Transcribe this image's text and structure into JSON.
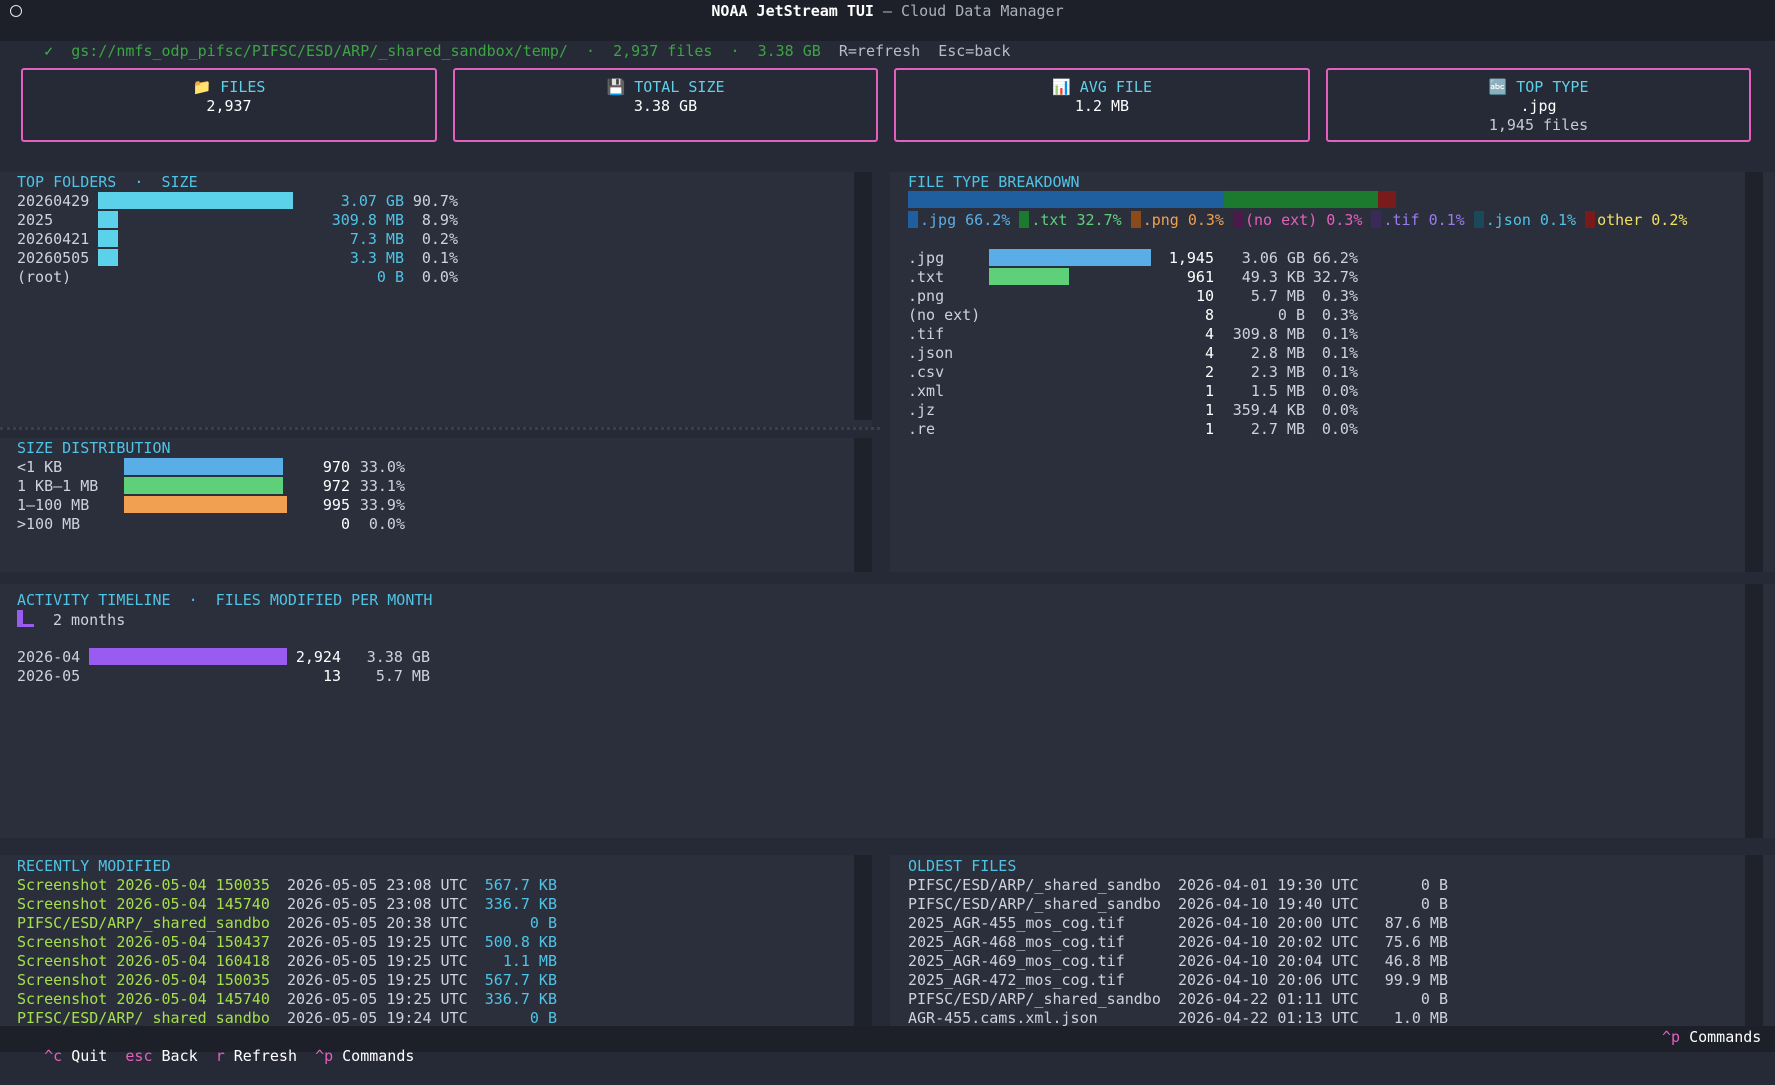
{
  "window": {
    "title_bold": "NOAA JetStream TUI",
    "title_rest": " — Cloud Data Manager"
  },
  "status": {
    "check": "✓",
    "path": "gs://nmfs_odp_pifsc/PIFSC/ESD/ARP/_shared_sandbox/temp/",
    "sep1": "·",
    "files": "2,937 files",
    "sep2": "·",
    "size": "3.38 GB",
    "hint_refresh": "R=refresh",
    "hint_back": "Esc=back"
  },
  "cards": {
    "files": {
      "icon": "📁",
      "label": "FILES",
      "value": "2,937"
    },
    "total": {
      "icon": "💾",
      "label": "TOTAL SIZE",
      "value": "3.38 GB"
    },
    "avg": {
      "icon": "📊",
      "label": "AVG FILE",
      "value": "1.2 MB"
    },
    "top": {
      "icon": "🔤",
      "label": "TOP TYPE",
      "value": ".jpg",
      "sub": "1,945 files"
    }
  },
  "top_folders": {
    "header": "TOP FOLDERS  ·  SIZE",
    "rows": [
      {
        "name": "20260429",
        "size": "3.07 GB",
        "pct": "90.7%",
        "frac": 0.907
      },
      {
        "name": "2025",
        "size": "309.8 MB",
        "pct": "8.9%",
        "frac": 0.089
      },
      {
        "name": "20260421",
        "size": "7.3 MB",
        "pct": "0.2%",
        "frac": 0.002
      },
      {
        "name": "20260505",
        "size": "3.3 MB",
        "pct": "0.1%",
        "frac": 0.001
      },
      {
        "name": "(root)",
        "size": "0 B",
        "pct": "0.0%",
        "frac": 0
      }
    ]
  },
  "size_dist": {
    "header": "SIZE DISTRIBUTION",
    "rows": [
      {
        "label": "<1 KB",
        "count": "970",
        "pct": "33.0%",
        "frac": 0.975,
        "color": "#5aaee8"
      },
      {
        "label": "1 KB–1 MB",
        "count": "972",
        "pct": "33.1%",
        "frac": 0.977,
        "color": "#5fd07a"
      },
      {
        "label": "1–100 MB",
        "count": "995",
        "pct": "33.9%",
        "frac": 1.0,
        "color": "#f0a050"
      },
      {
        "label": ">100 MB",
        "count": "0",
        "pct": "0.0%",
        "frac": 0,
        "color": "#888888"
      }
    ]
  },
  "file_types": {
    "header": "FILE TYPE BREAKDOWN",
    "stack_colors": [
      "#1f5fa0",
      "#1c7a2e",
      "#7a1a1a"
    ],
    "legend": [
      {
        "label": ".jpg 66.2%",
        "color": "#1f5fa0",
        "text_color": "#5aaee8"
      },
      {
        "label": ".txt 32.7%",
        "color": "#1c7a2e",
        "text_color": "#5fd07a"
      },
      {
        "label": ".png 0.3%",
        "color": "#8a4a1a",
        "text_color": "#f0a050"
      },
      {
        "label": "(no ext) 0.3%",
        "color": "#4a1a4a",
        "text_color": "#e45fbe"
      },
      {
        "label": ".tif 0.1%",
        "color": "#3a2a5a",
        "text_color": "#9a7af0"
      },
      {
        "label": ".json 0.1%",
        "color": "#1a4a5a",
        "text_color": "#4fc3e6"
      },
      {
        "label": "other 0.2%",
        "color": "#7a1a1a",
        "text_color": "#f0e060"
      }
    ],
    "rows": [
      {
        "ext": ".jpg",
        "count": "1,945",
        "size": "3.06 GB",
        "pct": "66.2%",
        "frac": 1.0,
        "color": "#5aaee8"
      },
      {
        "ext": ".txt",
        "count": "961",
        "size": "49.3 KB",
        "pct": "32.7%",
        "frac": 0.494,
        "color": "#5fd07a"
      },
      {
        "ext": ".png",
        "count": "10",
        "size": "5.7 MB",
        "pct": "0.3%",
        "frac": 0
      },
      {
        "ext": "(no ext)",
        "count": "8",
        "size": "0 B",
        "pct": "0.3%",
        "frac": 0
      },
      {
        "ext": ".tif",
        "count": "4",
        "size": "309.8 MB",
        "pct": "0.1%",
        "frac": 0
      },
      {
        "ext": ".json",
        "count": "4",
        "size": "2.8 MB",
        "pct": "0.1%",
        "frac": 0
      },
      {
        "ext": ".csv",
        "count": "2",
        "size": "2.3 MB",
        "pct": "0.1%",
        "frac": 0
      },
      {
        "ext": ".xml",
        "count": "1",
        "size": "1.5 MB",
        "pct": "0.0%",
        "frac": 0
      },
      {
        "ext": ".jz",
        "count": "1",
        "size": "359.4 KB",
        "pct": "0.0%",
        "frac": 0
      },
      {
        "ext": ".re",
        "count": "1",
        "size": "2.7 MB",
        "pct": "0.0%",
        "frac": 0
      }
    ]
  },
  "timeline": {
    "header": "ACTIVITY TIMELINE  ·  FILES MODIFIED PER MONTH",
    "months_label": "2 months",
    "rows": [
      {
        "month": "2026-04",
        "count": "2,924",
        "size": "3.38 GB",
        "frac": 1.0
      },
      {
        "month": "2026-05",
        "count": "13",
        "size": "5.7 MB",
        "frac": 0
      }
    ]
  },
  "recent": {
    "header": "RECENTLY MODIFIED",
    "rows": [
      {
        "name": "Screenshot 2026-05-04 150035",
        "date": "2026-05-05 23:08 UTC",
        "size": "567.7 KB"
      },
      {
        "name": "Screenshot 2026-05-04 145740",
        "date": "2026-05-05 23:08 UTC",
        "size": "336.7 KB"
      },
      {
        "name": "PIFSC/ESD/ARP/_shared_sandbo",
        "date": "2026-05-05 20:38 UTC",
        "size": "0 B"
      },
      {
        "name": "Screenshot 2026-05-04 150437",
        "date": "2026-05-05 19:25 UTC",
        "size": "500.8 KB"
      },
      {
        "name": "Screenshot 2026-05-04 160418",
        "date": "2026-05-05 19:25 UTC",
        "size": "1.1 MB"
      },
      {
        "name": "Screenshot 2026-05-04 150035",
        "date": "2026-05-05 19:25 UTC",
        "size": "567.7 KB"
      },
      {
        "name": "Screenshot 2026-05-04 145740",
        "date": "2026-05-05 19:25 UTC",
        "size": "336.7 KB"
      },
      {
        "name": "PIFSC/ESD/ARP/_shared_sandbo",
        "date": "2026-05-05 19:24 UTC",
        "size": "0 B"
      }
    ]
  },
  "oldest": {
    "header": "OLDEST FILES",
    "rows": [
      {
        "name": "PIFSC/ESD/ARP/_shared_sandbo",
        "date": "2026-04-01 19:30 UTC",
        "size": "0 B"
      },
      {
        "name": "PIFSC/ESD/ARP/_shared_sandbo",
        "date": "2026-04-10 19:40 UTC",
        "size": "0 B"
      },
      {
        "name": "2025_AGR-455_mos_cog.tif",
        "date": "2026-04-10 20:00 UTC",
        "size": "87.6 MB"
      },
      {
        "name": "2025_AGR-468_mos_cog.tif",
        "date": "2026-04-10 20:02 UTC",
        "size": "75.6 MB"
      },
      {
        "name": "2025_AGR-469_mos_cog.tif",
        "date": "2026-04-10 20:04 UTC",
        "size": "46.8 MB"
      },
      {
        "name": "2025_AGR-472_mos_cog.tif",
        "date": "2026-04-10 20:06 UTC",
        "size": "99.9 MB"
      },
      {
        "name": "PIFSC/ESD/ARP/_shared_sandbo",
        "date": "2026-04-22 01:11 UTC",
        "size": "0 B"
      },
      {
        "name": "AGR-455.cams.xml.json",
        "date": "2026-04-22 01:13 UTC",
        "size": "1.0 MB"
      }
    ]
  },
  "footer": {
    "quit_key": "^c",
    "quit": "Quit",
    "back_key": "esc",
    "back": "Back",
    "refresh_key": "r",
    "refresh": "Refresh",
    "cmd_key": "^p",
    "cmd": "Commands",
    "cmd_key_right": "^p",
    "cmd_right": "Commands"
  }
}
